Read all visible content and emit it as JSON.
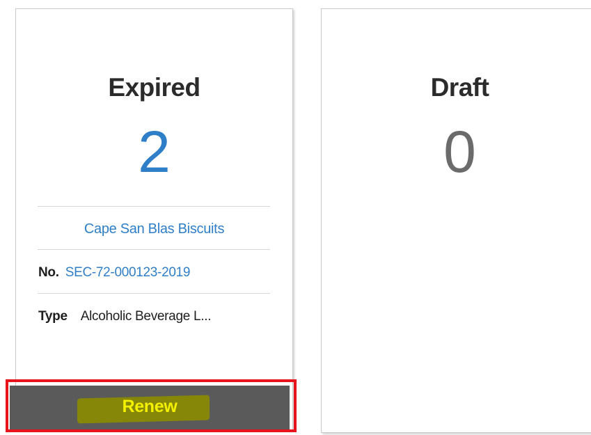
{
  "cards": [
    {
      "title": "Expired",
      "count": "2",
      "business_name": "Cape San Blas Biscuits",
      "number_label": "No.",
      "number_value": "SEC-72-000123-2019",
      "type_label": "Type",
      "type_value": "Alcoholic Beverage L...",
      "action_label": "Renew"
    },
    {
      "title": "Draft",
      "count": "0"
    }
  ],
  "colors": {
    "link_blue": "#2f7fc8",
    "count_gray": "#6b6b6b",
    "button_bg": "#5a5a5a",
    "button_text": "#f3f000",
    "highlight_frame": "#e8141b"
  }
}
